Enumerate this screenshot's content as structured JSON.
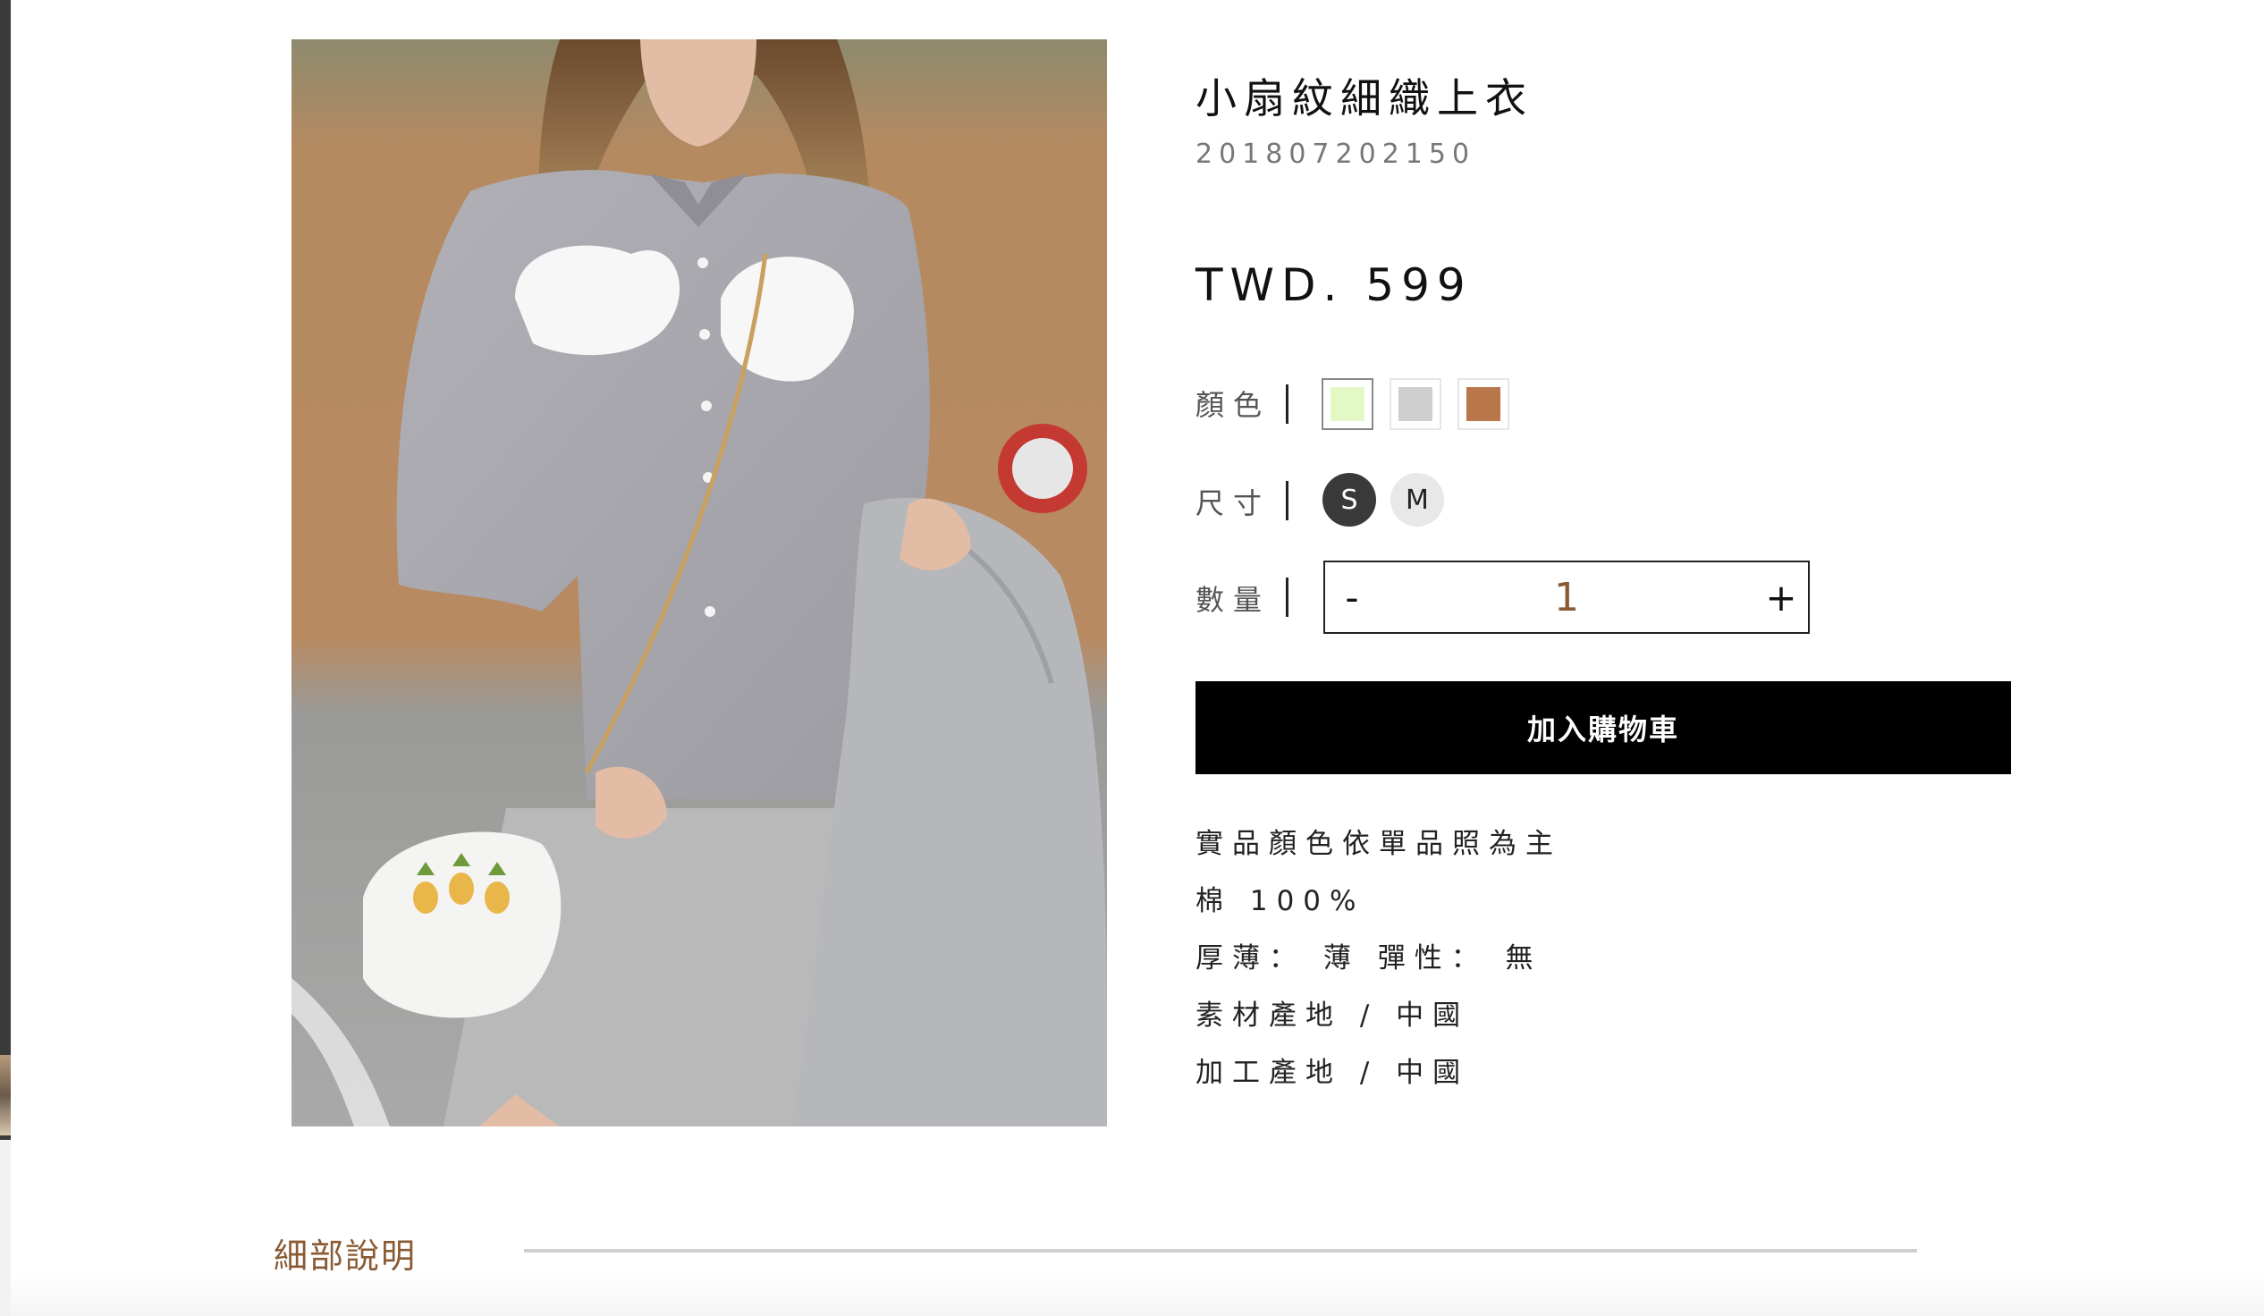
{
  "product": {
    "title": "小扇紋細織上衣",
    "sku": "201807202150",
    "price": "TWD. 599"
  },
  "options": {
    "color_label": "顏色",
    "size_label": "尺寸",
    "quantity_label": "數量",
    "colors": [
      {
        "name": "light-green",
        "hex": "#e2f9c6",
        "selected": true
      },
      {
        "name": "gray",
        "hex": "#cfcfcf",
        "selected": false
      },
      {
        "name": "brown",
        "hex": "#b8764a",
        "selected": false
      }
    ],
    "sizes": [
      {
        "label": "S",
        "selected": true
      },
      {
        "label": "M",
        "selected": false
      }
    ],
    "quantity": {
      "minus": "-",
      "value": "1",
      "plus": "+"
    }
  },
  "add_to_cart_label": "加入購物車",
  "details": [
    "實品顏色依單品照為主",
    "棉 100%",
    "厚薄： 薄 彈性： 無",
    "素材產地 / 中國",
    "加工產地 / 中國"
  ],
  "section": {
    "title": "細部說明"
  },
  "colors": {
    "accent": "#8a5a32",
    "button_bg": "#000000",
    "selected_size_bg": "#3a3a3a"
  }
}
